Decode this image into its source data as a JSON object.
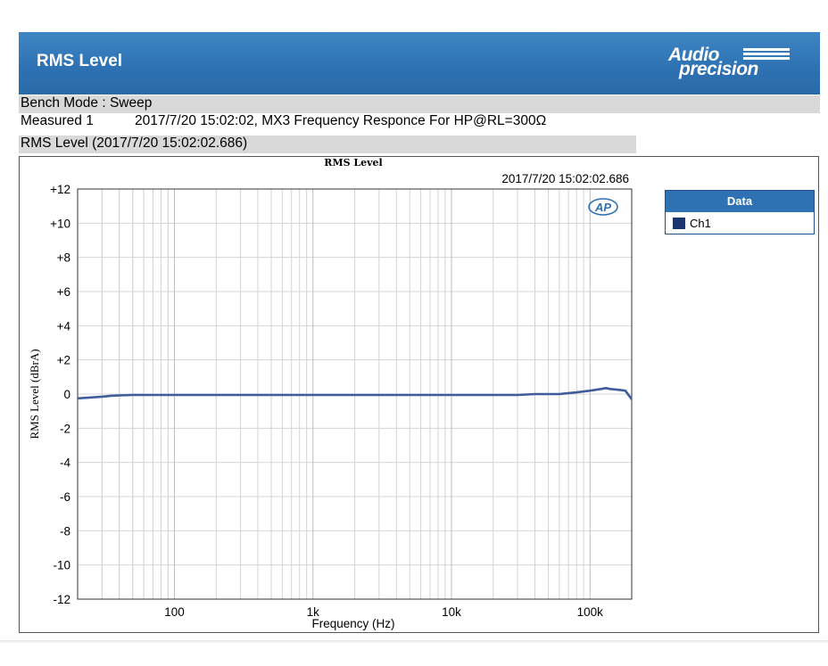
{
  "header": {
    "title": "RMS Level",
    "logo_line1": "Audio",
    "logo_line2": "precision"
  },
  "info": {
    "mode": "Bench Mode : Sweep",
    "measured_label": "Measured 1",
    "measured_value": "2017/7/20 15:02:02, MX3 Frequency Responce For HP@RL=300Ω",
    "graph_caption": "RMS Level (2017/7/20 15:02:02.686)"
  },
  "legend": {
    "title": "Data",
    "items": [
      {
        "label": "Ch1",
        "color": "#1c3570"
      }
    ]
  },
  "colors": {
    "banner": "#2e72b3",
    "trace": "#3f5d9c",
    "grid": "#d4d4d4"
  },
  "chart_data": {
    "type": "line",
    "title": "RMS Level",
    "subtitle": "2017/7/20 15:02:02.686",
    "badge": "AP",
    "xlabel": "Frequency (Hz)",
    "ylabel": "RMS Level (dBrA)",
    "xscale": "log",
    "xlim": [
      20,
      200000
    ],
    "ylim": [
      -12,
      12
    ],
    "xticks": [
      {
        "value": 100,
        "label": "100"
      },
      {
        "value": 1000,
        "label": "1k"
      },
      {
        "value": 10000,
        "label": "10k"
      },
      {
        "value": 100000,
        "label": "100k"
      }
    ],
    "yticks": [
      {
        "value": 12,
        "label": "+12"
      },
      {
        "value": 10,
        "label": "+10"
      },
      {
        "value": 8,
        "label": "+8"
      },
      {
        "value": 6,
        "label": "+6"
      },
      {
        "value": 4,
        "label": "+4"
      },
      {
        "value": 2,
        "label": "+2"
      },
      {
        "value": 0,
        "label": "0"
      },
      {
        "value": -2,
        "label": "-2"
      },
      {
        "value": -4,
        "label": "-4"
      },
      {
        "value": -6,
        "label": "-6"
      },
      {
        "value": -8,
        "label": "-8"
      },
      {
        "value": -10,
        "label": "-10"
      },
      {
        "value": -12,
        "label": "-12"
      }
    ],
    "grid": true,
    "legend_position": "right",
    "series": [
      {
        "name": "Ch1",
        "x": [
          20,
          25,
          30,
          35,
          40,
          50,
          100,
          1000,
          10000,
          30000,
          40000,
          60000,
          80000,
          100000,
          120000,
          130000,
          140000,
          160000,
          180000,
          200000
        ],
        "y": [
          -0.25,
          -0.2,
          -0.15,
          -0.1,
          -0.08,
          -0.05,
          -0.05,
          -0.05,
          -0.05,
          -0.05,
          0.0,
          0.0,
          0.1,
          0.2,
          0.3,
          0.35,
          0.3,
          0.25,
          0.2,
          -0.3
        ]
      }
    ]
  }
}
